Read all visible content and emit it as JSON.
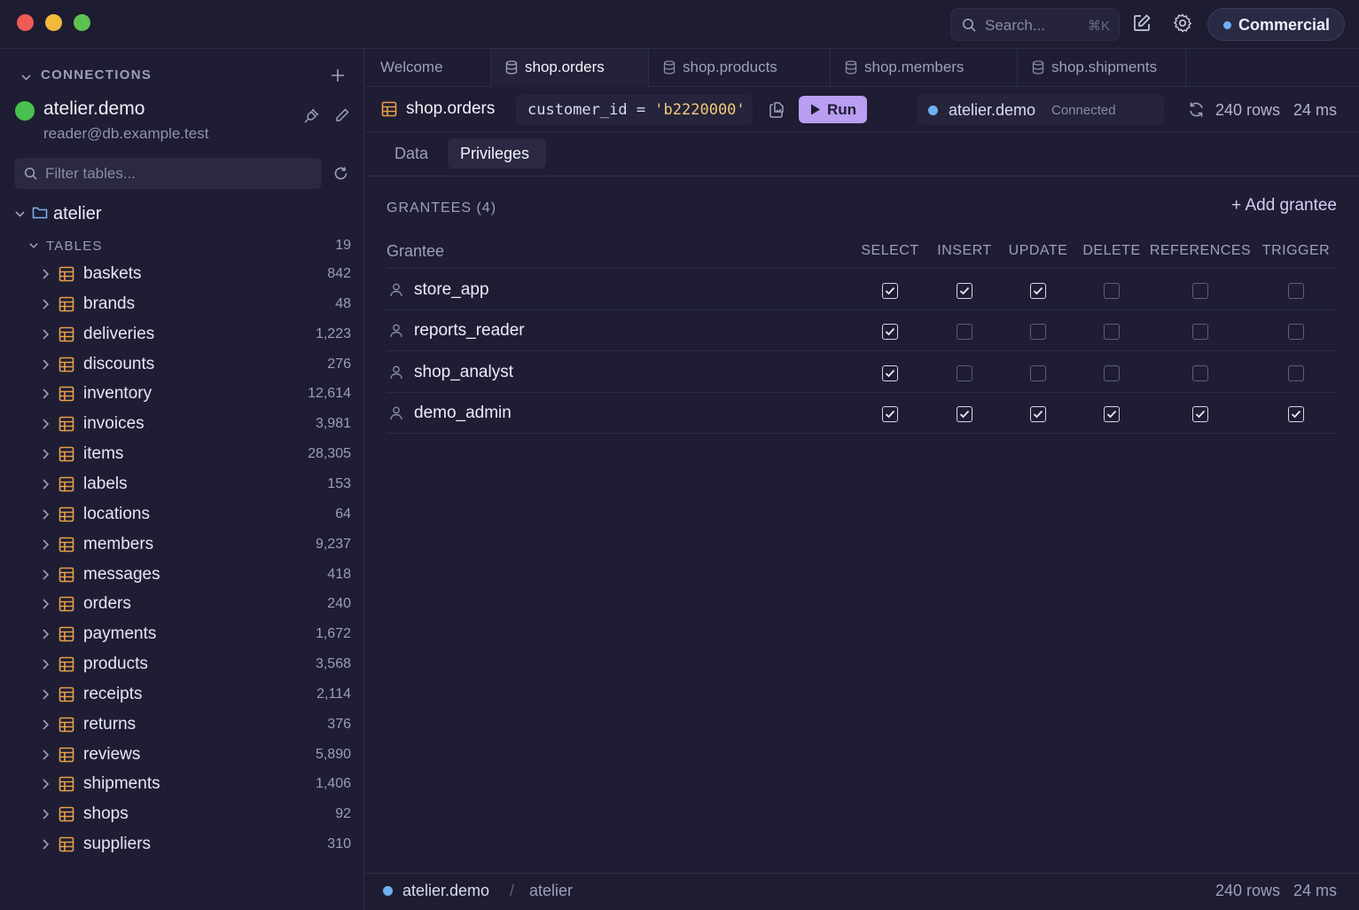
{
  "titlebar": {
    "search_placeholder": "Search...",
    "search_shortcut": "⌘K",
    "plan_label": "Commercial"
  },
  "sidebar": {
    "header": "CONNECTIONS",
    "connection": {
      "name": "atelier.demo",
      "user": "reader@db.example.test",
      "status_color": "#49c04f"
    },
    "filter_placeholder": "Filter tables...",
    "database": "atelier",
    "tables_label": "TABLES",
    "tables_count": "19",
    "tables": [
      {
        "name": "baskets",
        "count": "842"
      },
      {
        "name": "brands",
        "count": "48"
      },
      {
        "name": "deliveries",
        "count": "1,223"
      },
      {
        "name": "discounts",
        "count": "276"
      },
      {
        "name": "inventory",
        "count": "12,614"
      },
      {
        "name": "invoices",
        "count": "3,981"
      },
      {
        "name": "items",
        "count": "28,305"
      },
      {
        "name": "labels",
        "count": "153"
      },
      {
        "name": "locations",
        "count": "64"
      },
      {
        "name": "members",
        "count": "9,237"
      },
      {
        "name": "messages",
        "count": "418"
      },
      {
        "name": "orders",
        "count": "240"
      },
      {
        "name": "payments",
        "count": "1,672"
      },
      {
        "name": "products",
        "count": "3,568"
      },
      {
        "name": "receipts",
        "count": "2,114"
      },
      {
        "name": "returns",
        "count": "376"
      },
      {
        "name": "reviews",
        "count": "5,890"
      },
      {
        "name": "shipments",
        "count": "1,406"
      },
      {
        "name": "shops",
        "count": "92"
      },
      {
        "name": "suppliers",
        "count": "310"
      }
    ]
  },
  "tabs": [
    {
      "label": "Welcome"
    },
    {
      "label": "shop.orders"
    },
    {
      "label": "shop.products"
    },
    {
      "label": "shop.members"
    },
    {
      "label": "shop.shipments"
    }
  ],
  "toolbar": {
    "title": "shop.orders",
    "query_column": "customer_id = ",
    "query_value": "'b2220000'",
    "run_label": "Run",
    "connection_name": "atelier.demo",
    "connection_status": "Connected",
    "stats": "240 rows   24 ms"
  },
  "subtabs": [
    {
      "label": "Data"
    },
    {
      "label": "Privileges"
    }
  ],
  "privileges": {
    "heading": "GRANTEES (4)",
    "add_label": "+ Add grantee",
    "grantee_header": "Grantee",
    "columns": [
      "SELECT",
      "INSERT",
      "UPDATE",
      "DELETE",
      "REFERENCES",
      "TRIGGER"
    ],
    "grantees": [
      {
        "name": "store_app",
        "perms": [
          true,
          true,
          true,
          false,
          false,
          false
        ]
      },
      {
        "name": "reports_reader",
        "perms": [
          true,
          false,
          false,
          false,
          false,
          false
        ]
      },
      {
        "name": "shop_analyst",
        "perms": [
          true,
          false,
          false,
          false,
          false,
          false
        ]
      },
      {
        "name": "demo_admin",
        "perms": [
          true,
          true,
          true,
          true,
          true,
          true
        ]
      }
    ]
  },
  "statusbar": {
    "connection": "atelier.demo",
    "separator": "/",
    "database": "atelier",
    "rows": "240 rows   24 ms"
  },
  "colors": {
    "accent": "#b99ef2",
    "table_icon": "#e8a04a",
    "connected_dot": "#6db0f0"
  }
}
